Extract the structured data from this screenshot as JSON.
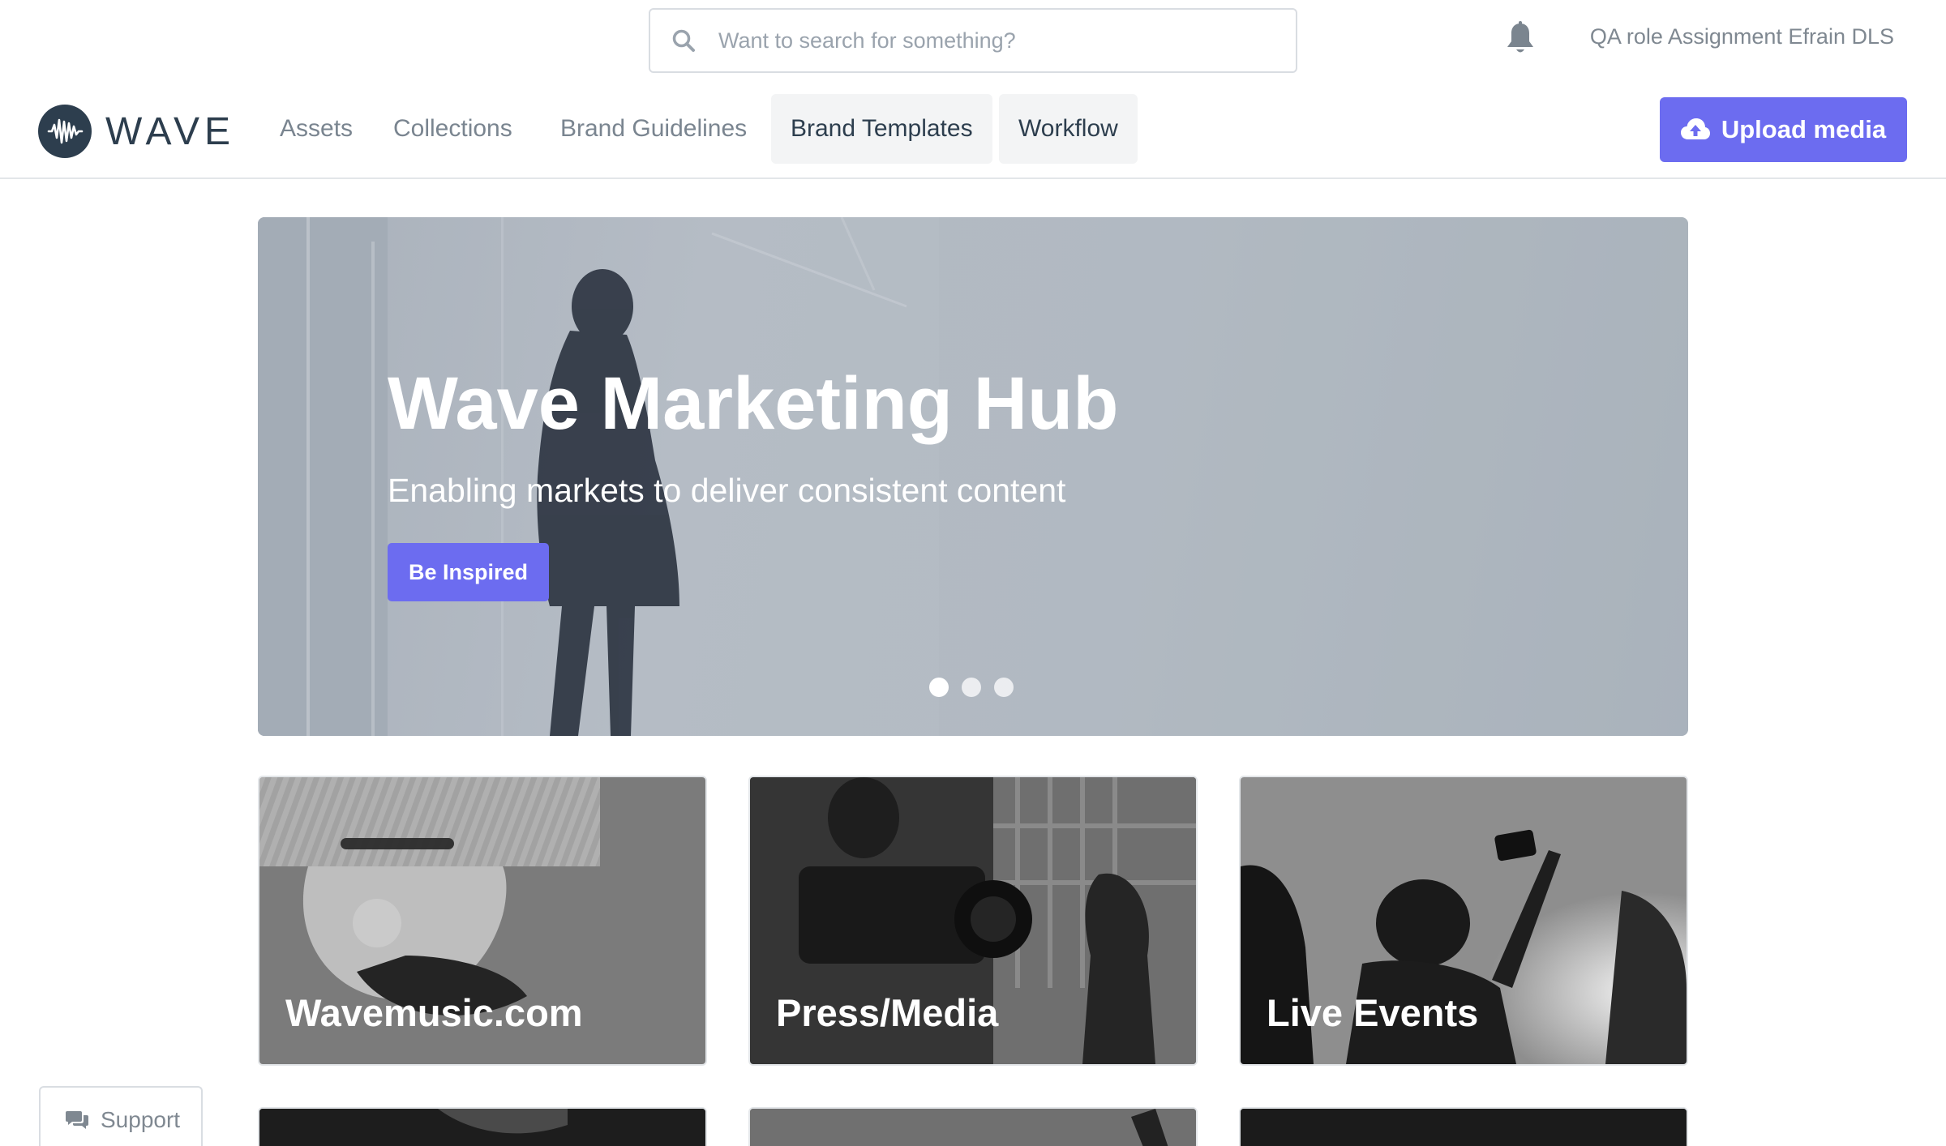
{
  "header": {
    "search_placeholder": "Want to search for something?",
    "search_icon": "search-icon",
    "bell_icon": "bell-icon",
    "user_name": "QA role Assignment Efrain DLS"
  },
  "nav": {
    "logo_text": "WAVE",
    "items": [
      {
        "label": "Assets",
        "active": false
      },
      {
        "label": "Collections",
        "active": false
      },
      {
        "label": "Brand Guidelines",
        "active": false
      },
      {
        "label": "Brand Templates",
        "active": true
      },
      {
        "label": "Workflow",
        "active": true
      }
    ],
    "upload_label": "Upload media",
    "upload_icon": "cloud-upload-icon"
  },
  "hero": {
    "title": "Wave Marketing Hub",
    "subtitle": "Enabling markets to deliver consistent content",
    "button_label": "Be Inspired",
    "slide_count": 3,
    "active_slide": 1
  },
  "cards": [
    {
      "label": "Wavemusic.com"
    },
    {
      "label": "Press/Media"
    },
    {
      "label": "Live Events"
    }
  ],
  "support": {
    "label": "Support",
    "icon": "chat-icon"
  },
  "colors": {
    "accent": "#6c6cf0",
    "logo": "#2d3e4e",
    "muted_text": "#7a8590"
  }
}
